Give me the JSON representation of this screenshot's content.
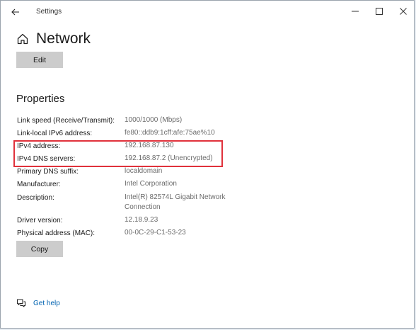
{
  "window": {
    "title": "Settings",
    "controls": {
      "minimize_icon": "minimize-icon",
      "maximize_icon": "maximize-icon",
      "close_icon": "close-icon"
    }
  },
  "header": {
    "title": "Network",
    "icon": "home-icon",
    "edit_label": "Edit"
  },
  "properties": {
    "section_title": "Properties",
    "rows": [
      {
        "label": "Link speed (Receive/Transmit):",
        "value": "1000/1000 (Mbps)"
      },
      {
        "label": "Link-local IPv6 address:",
        "value": "fe80::ddb9:1cff:afe:75ae%10"
      },
      {
        "label": "IPv4 address:",
        "value": "192.168.87.130"
      },
      {
        "label": "IPv4 DNS servers:",
        "value": "192.168.87.2 (Unencrypted)"
      },
      {
        "label": "Primary DNS suffix:",
        "value": "localdomain"
      },
      {
        "label": "Manufacturer:",
        "value": "Intel Corporation"
      },
      {
        "label": "Description:",
        "value": "Intel(R) 82574L Gigabit Network",
        "value2": "Connection"
      },
      {
        "label": "Driver version:",
        "value": "12.18.9.23"
      },
      {
        "label": "Physical address (MAC):",
        "value": "00-0C-29-C1-53-23"
      }
    ],
    "copy_label": "Copy"
  },
  "help": {
    "label": "Get help",
    "icon": "help-chat-icon"
  },
  "colors": {
    "highlight_border": "#e0313b",
    "link": "#0063b1",
    "button_bg": "#cccccc"
  }
}
